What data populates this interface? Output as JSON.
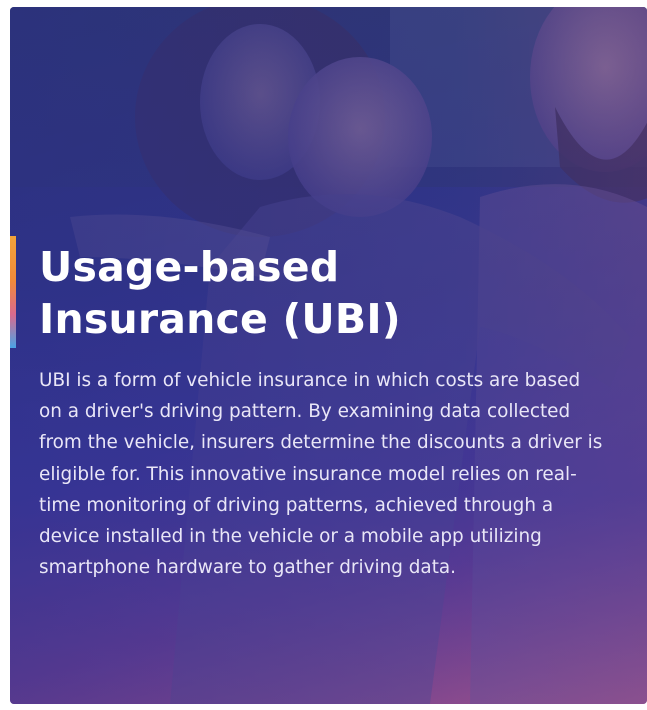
{
  "card": {
    "title_lines": [
      "Usage-based",
      "Insurance (UBI)"
    ],
    "description": "UBI is a form of vehicle insurance in which costs are based on a driver's driving pattern. By examining data collected from the vehicle, insurers determine the discounts a driver is eligible for. This innovative insurance model relies on real-time monitoring of driving patterns, achieved through a device installed in the vehicle or a mobile app utilizing smartphone hardware to gather driving data."
  },
  "colors": {
    "accent_top": "#f2a33a",
    "accent_bottom": "#4aa3e6",
    "overlay_primary": "#31378a",
    "overlay_secondary": "#b05a8a",
    "text": "#ffffff"
  }
}
